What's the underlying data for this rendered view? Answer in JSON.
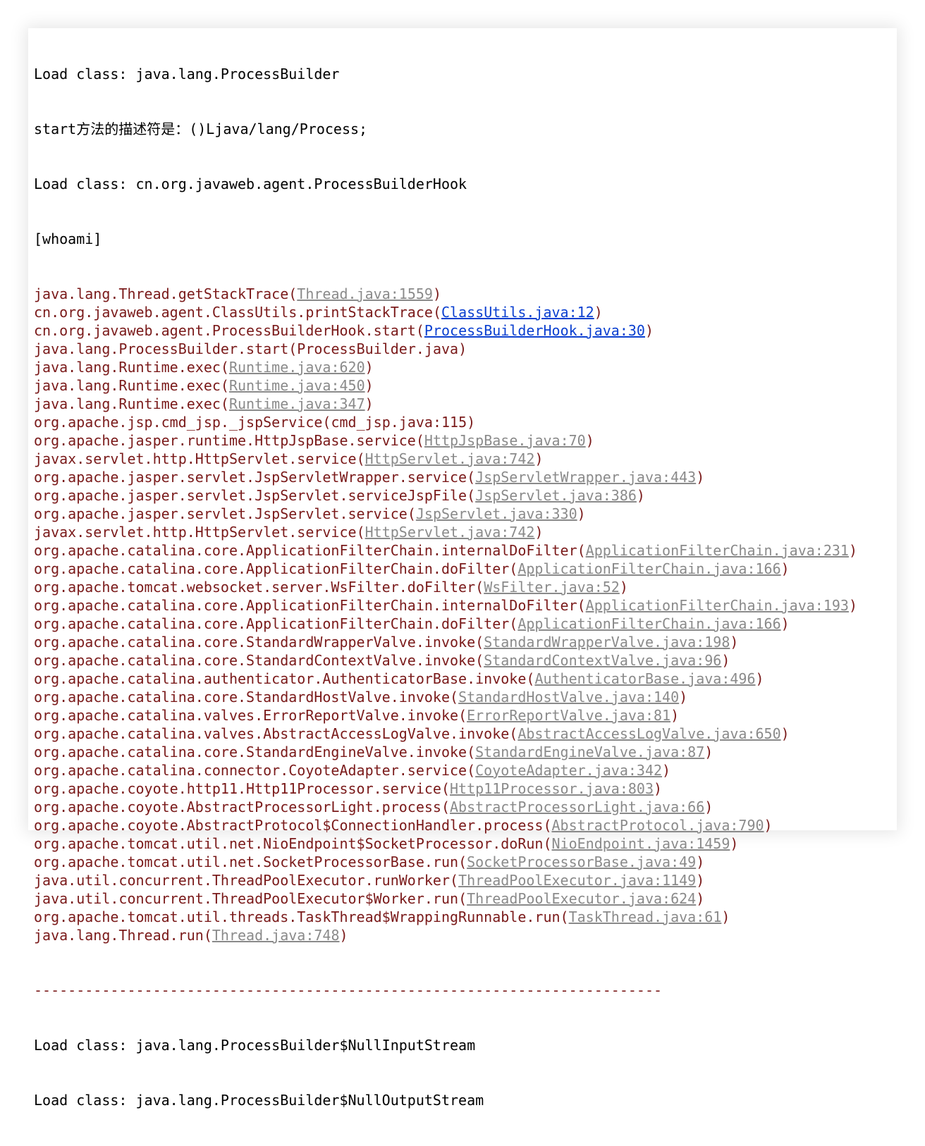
{
  "console": {
    "header_lines": [
      "Load class: java.lang.ProcessBuilder",
      "start方法的描述符是：()Ljava/lang/Process;",
      "Load class: cn.org.javaweb.agent.ProcessBuilderHook",
      "[whoami]"
    ],
    "trace": [
      {
        "method": "java.lang.Thread.getStackTrace",
        "loc": "Thread.java:1559",
        "link": "gray"
      },
      {
        "method": "cn.org.javaweb.agent.ClassUtils.printStackTrace",
        "loc": "ClassUtils.java:12",
        "link": "blue"
      },
      {
        "method": "cn.org.javaweb.agent.ProcessBuilderHook.start",
        "loc": "ProcessBuilderHook.java:30",
        "link": "blue"
      },
      {
        "method": "java.lang.ProcessBuilder.start",
        "loc": "ProcessBuilder.java",
        "link": "none"
      },
      {
        "method": "java.lang.Runtime.exec",
        "loc": "Runtime.java:620",
        "link": "gray"
      },
      {
        "method": "java.lang.Runtime.exec",
        "loc": "Runtime.java:450",
        "link": "gray"
      },
      {
        "method": "java.lang.Runtime.exec",
        "loc": "Runtime.java:347",
        "link": "gray"
      },
      {
        "method": "org.apache.jsp.cmd_jsp._jspService",
        "loc": "cmd_jsp.java:115",
        "link": "none"
      },
      {
        "method": "org.apache.jasper.runtime.HttpJspBase.service",
        "loc": "HttpJspBase.java:70",
        "link": "gray"
      },
      {
        "method": "javax.servlet.http.HttpServlet.service",
        "loc": "HttpServlet.java:742",
        "link": "gray"
      },
      {
        "method": "org.apache.jasper.servlet.JspServletWrapper.service",
        "loc": "JspServletWrapper.java:443",
        "link": "gray"
      },
      {
        "method": "org.apache.jasper.servlet.JspServlet.serviceJspFile",
        "loc": "JspServlet.java:386",
        "link": "gray"
      },
      {
        "method": "org.apache.jasper.servlet.JspServlet.service",
        "loc": "JspServlet.java:330",
        "link": "gray"
      },
      {
        "method": "javax.servlet.http.HttpServlet.service",
        "loc": "HttpServlet.java:742",
        "link": "gray"
      },
      {
        "method": "org.apache.catalina.core.ApplicationFilterChain.internalDoFilter",
        "loc": "ApplicationFilterChain.java:231",
        "link": "gray"
      },
      {
        "method": "org.apache.catalina.core.ApplicationFilterChain.doFilter",
        "loc": "ApplicationFilterChain.java:166",
        "link": "gray"
      },
      {
        "method": "org.apache.tomcat.websocket.server.WsFilter.doFilter",
        "loc": "WsFilter.java:52",
        "link": "gray"
      },
      {
        "method": "org.apache.catalina.core.ApplicationFilterChain.internalDoFilter",
        "loc": "ApplicationFilterChain.java:193",
        "link": "gray"
      },
      {
        "method": "org.apache.catalina.core.ApplicationFilterChain.doFilter",
        "loc": "ApplicationFilterChain.java:166",
        "link": "gray"
      },
      {
        "method": "org.apache.catalina.core.StandardWrapperValve.invoke",
        "loc": "StandardWrapperValve.java:198",
        "link": "gray"
      },
      {
        "method": "org.apache.catalina.core.StandardContextValve.invoke",
        "loc": "StandardContextValve.java:96",
        "link": "gray"
      },
      {
        "method": "org.apache.catalina.authenticator.AuthenticatorBase.invoke",
        "loc": "AuthenticatorBase.java:496",
        "link": "gray"
      },
      {
        "method": "org.apache.catalina.core.StandardHostValve.invoke",
        "loc": "StandardHostValve.java:140",
        "link": "gray"
      },
      {
        "method": "org.apache.catalina.valves.ErrorReportValve.invoke",
        "loc": "ErrorReportValve.java:81",
        "link": "gray"
      },
      {
        "method": "org.apache.catalina.valves.AbstractAccessLogValve.invoke",
        "loc": "AbstractAccessLogValve.java:650",
        "link": "gray"
      },
      {
        "method": "org.apache.catalina.core.StandardEngineValve.invoke",
        "loc": "StandardEngineValve.java:87",
        "link": "gray"
      },
      {
        "method": "org.apache.catalina.connector.CoyoteAdapter.service",
        "loc": "CoyoteAdapter.java:342",
        "link": "gray"
      },
      {
        "method": "org.apache.coyote.http11.Http11Processor.service",
        "loc": "Http11Processor.java:803",
        "link": "gray"
      },
      {
        "method": "org.apache.coyote.AbstractProcessorLight.process",
        "loc": "AbstractProcessorLight.java:66",
        "link": "gray"
      },
      {
        "method": "org.apache.coyote.AbstractProtocol$ConnectionHandler.process",
        "loc": "AbstractProtocol.java:790",
        "link": "gray"
      },
      {
        "method": "org.apache.tomcat.util.net.NioEndpoint$SocketProcessor.doRun",
        "loc": "NioEndpoint.java:1459",
        "link": "gray"
      },
      {
        "method": "org.apache.tomcat.util.net.SocketProcessorBase.run",
        "loc": "SocketProcessorBase.java:49",
        "link": "gray"
      },
      {
        "method": "java.util.concurrent.ThreadPoolExecutor.runWorker",
        "loc": "ThreadPoolExecutor.java:1149",
        "link": "gray"
      },
      {
        "method": "java.util.concurrent.ThreadPoolExecutor$Worker.run",
        "loc": "ThreadPoolExecutor.java:624",
        "link": "gray"
      },
      {
        "method": "org.apache.tomcat.util.threads.TaskThread$WrappingRunnable.run",
        "loc": "TaskThread.java:61",
        "link": "gray"
      },
      {
        "method": "java.lang.Thread.run",
        "loc": "Thread.java:748",
        "link": "gray"
      }
    ],
    "separator": "--------------------------------------------------------------------------",
    "footer_lines": [
      "Load class: java.lang.ProcessBuilder$NullInputStream",
      "Load class: java.lang.ProcessBuilder$NullOutputStream"
    ],
    "colors": {
      "plain_text": "#000000",
      "trace_text": "#7a1a1a",
      "link_gray": "#8a8a8a",
      "link_blue": "#0a3fd0"
    }
  }
}
